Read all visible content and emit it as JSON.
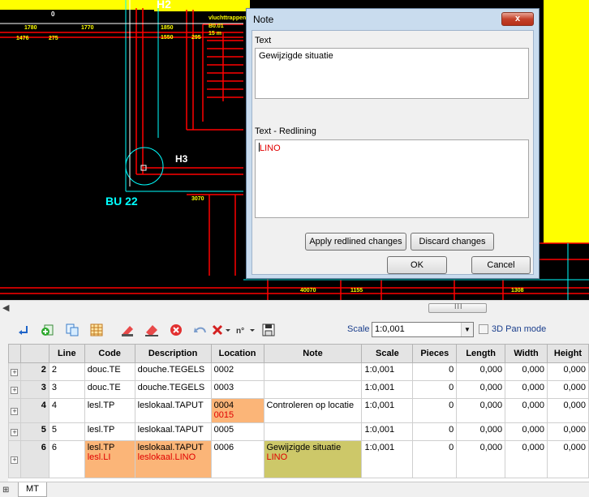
{
  "cad": {
    "labels": {
      "h2": "H2",
      "h3": "H3",
      "bu22": "BU 22",
      "zero": "0",
      "v1780": "1780",
      "v1770": "1770",
      "v1476": "1476",
      "v275": "275",
      "v1850": "1850",
      "v1550": "1550",
      "v295": "295",
      "vluchttrap": "vluchttrappenhuis",
      "b001": "B0.01",
      "m15": "15 m",
      "v3070": "3070",
      "v40070": "40070",
      "v1155": "1155",
      "v1308": "1308"
    }
  },
  "scrollbar": {
    "thumb_label": "III"
  },
  "toolbar": {
    "scale_label": "Scale",
    "scale_value": "1:0,001",
    "pan_mode_label": "3D Pan mode"
  },
  "grid": {
    "headers": [
      "Line",
      "Code",
      "Description",
      "Location",
      "Note",
      "Scale",
      "Pieces",
      "Length",
      "Width",
      "Height"
    ],
    "rows": [
      {
        "idx": "2",
        "line": "2",
        "code": "douc.TE",
        "description": "douche.TEGELS",
        "location": "0002",
        "note": "",
        "scale": "1:0,001",
        "pieces": "0",
        "length": "0,000",
        "width": "0,000",
        "height": "0,000"
      },
      {
        "idx": "3",
        "line": "3",
        "code": "douc.TE",
        "description": "douche.TEGELS",
        "location": "0003",
        "note": "",
        "scale": "1:0,001",
        "pieces": "0",
        "length": "0,000",
        "width": "0,000",
        "height": "0,000"
      },
      {
        "idx": "4",
        "line": "4",
        "code": "lesl.TP",
        "description": "leslokaal.TAPUT",
        "location": "0004",
        "location_red": "0015",
        "note": "Controleren op locatie",
        "scale": "1:0,001",
        "pieces": "0",
        "length": "0,000",
        "width": "0,000",
        "height": "0,000"
      },
      {
        "idx": "5",
        "line": "5",
        "code": "lesl.TP",
        "description": "leslokaal.TAPUT",
        "location": "0005",
        "note": "",
        "scale": "1:0,001",
        "pieces": "0",
        "length": "0,000",
        "width": "0,000",
        "height": "0,000"
      },
      {
        "idx": "6",
        "line": "6",
        "code": "lesl.TP",
        "code_red": "lesl.LI",
        "description": "leslokaal.TAPUT",
        "description_red": "leslokaal.LINO",
        "location": "0006",
        "note": "Gewijzigde situatie",
        "note_red": "LINO",
        "scale": "1:0,001",
        "pieces": "0",
        "length": "0,000",
        "width": "0,000",
        "height": "0,000"
      }
    ]
  },
  "bottom_tab": {
    "label": "MT"
  },
  "dialog": {
    "title": "Note",
    "close_label": "x",
    "text_label": "Text",
    "text_value": "Gewijzigde situatie",
    "redlining_label": "Text - Redlining",
    "redlining_value": "LINO",
    "apply_label": "Apply redlined changes",
    "discard_label": "Discard changes",
    "ok_label": "OK",
    "cancel_label": "Cancel"
  },
  "colors": {
    "cad_background": "#000000",
    "cad_yellow": "#ffff00",
    "cad_red": "#ff0000",
    "cad_cyan": "#00ffff",
    "highlight_orange": "#fbb578",
    "highlight_olive": "#cdc869",
    "redline_text": "#e00000"
  }
}
